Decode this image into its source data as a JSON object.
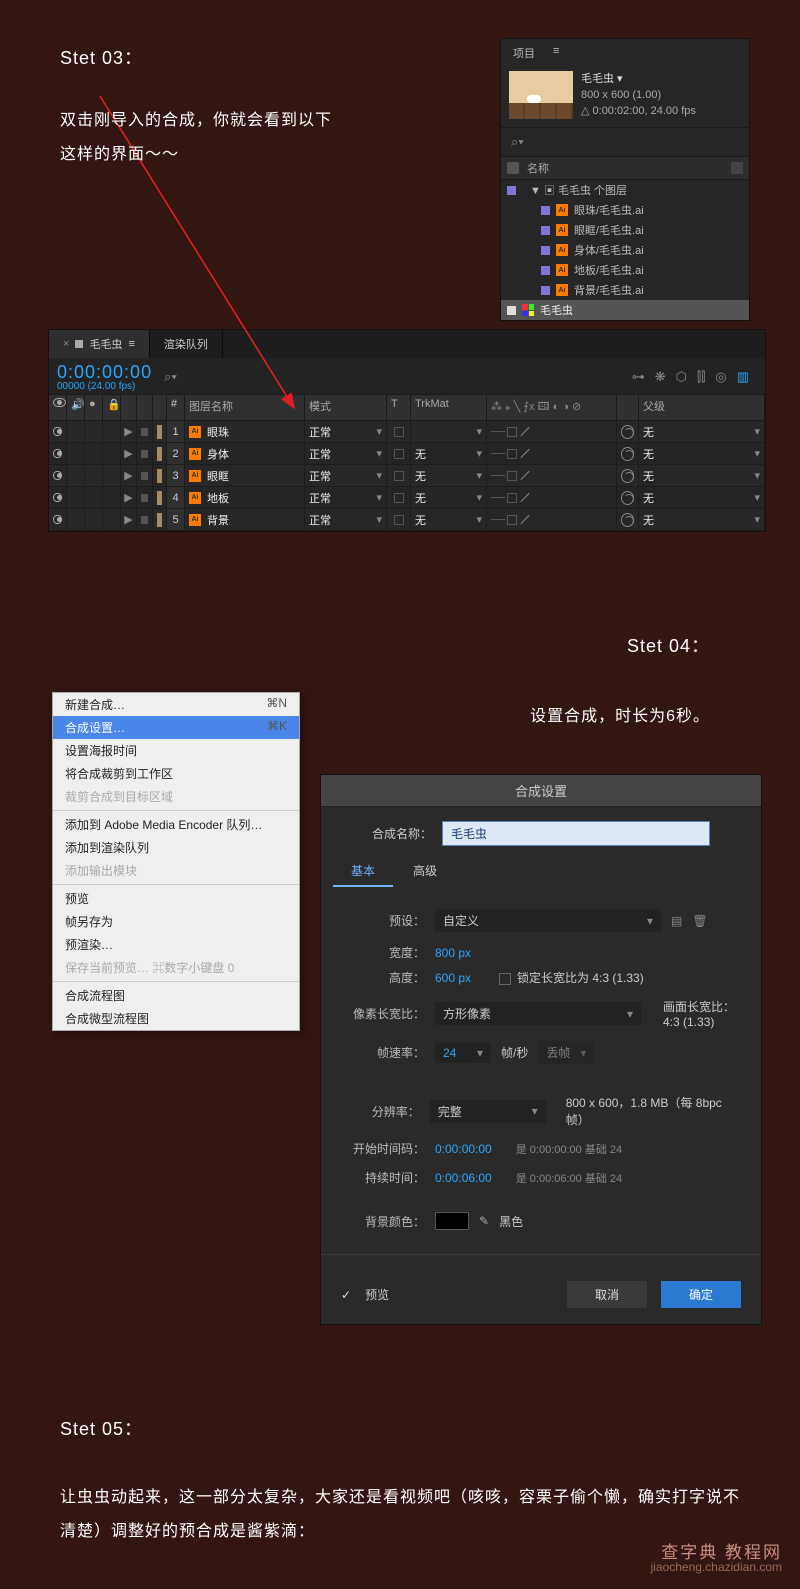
{
  "step3": {
    "title": "Stet 03：",
    "text1": "双击刚导入的合成，你就会看到以下",
    "text2": "这样的界面～～"
  },
  "step4": {
    "title": "Stet 04：",
    "text": "设置合成，时长为6秒。"
  },
  "step5": {
    "title": "Stet 05：",
    "text": "让虫虫动起来，这一部分太复杂，大家还是看视频吧（咳咳，容栗子偷个懒，确实打字说不清楚）调整好的预合成是酱紫滴："
  },
  "project": {
    "tab": "项目",
    "menu_glyph": "≡",
    "comp_name": "毛毛虫 ▾",
    "dims": "800 x 600 (1.00)",
    "duration": "△ 0:00:02:00, 24.00 fps",
    "search_glyph": "⌕▾",
    "tag_col": "",
    "name_col": "名称",
    "folder": "▼ ▣ 毛毛虫 个图层",
    "assets": [
      "眼珠/毛毛虫.ai",
      "眼眶/毛毛虫.ai",
      "身体/毛毛虫.ai",
      "地板/毛毛虫.ai",
      "背景/毛毛虫.ai"
    ],
    "bottom_comp": "毛毛虫"
  },
  "timeline": {
    "tabs": {
      "active": "毛毛虫",
      "menu_glyph": "≡",
      "render": "渲染队列"
    },
    "timecode": "0:00:00:00",
    "sub": "00000 (24.00 fps)",
    "search_glyph": "⌕▾",
    "headers": {
      "hnum": "#",
      "name": "图层名称",
      "mode": "模式",
      "t": "T",
      "trk": "TrkMat",
      "switches": "⁂ ⁎ ╲ ⨍x 🖽 ◐ ◑ ⊘",
      "parent": "父级"
    },
    "rows": [
      {
        "num": "1",
        "name": "眼珠",
        "mode": "正常",
        "trk": "",
        "parent": "无"
      },
      {
        "num": "2",
        "name": "身体",
        "mode": "正常",
        "trk": "无",
        "parent": "无"
      },
      {
        "num": "3",
        "name": "眼眶",
        "mode": "正常",
        "trk": "无",
        "parent": "无"
      },
      {
        "num": "4",
        "name": "地板",
        "mode": "正常",
        "trk": "无",
        "parent": "无"
      },
      {
        "num": "5",
        "name": "背景",
        "mode": "正常",
        "trk": "无",
        "parent": "无"
      }
    ]
  },
  "menu": {
    "new_comp": "新建合成…",
    "new_comp_sc": "⌘N",
    "comp_settings": "合成设置…",
    "comp_settings_sc": "⌘K",
    "poster": "设置海报时间",
    "crop": "将合成裁剪到工作区",
    "crop_target": "裁剪合成到目标区域",
    "ame": "添加到 Adobe Media Encoder 队列…",
    "render_q": "添加到渲染队列",
    "output_mod": "添加输出模块",
    "preview": "预览",
    "save_frame": "帧另存为",
    "prerender": "预渲染…",
    "save_preview": "保存当前预览…   ⌘数字小键盘 0",
    "flowchart": "合成流程图",
    "miniflow": "合成微型流程图"
  },
  "dialog": {
    "title": "合成设置",
    "name_label": "合成名称：",
    "name_value": "毛毛虫",
    "tab_basic": "基本",
    "tab_advanced": "高级",
    "preset_label": "预设：",
    "preset_value": "自定义",
    "width_label": "宽度：",
    "width_value": "800 px",
    "height_label": "高度：",
    "height_value": "600 px",
    "lock_aspect": "锁定长宽比为 4:3 (1.33)",
    "par_label": "像素长宽比：",
    "par_value": "方形像素",
    "frame_aspect_label": "画面长宽比：",
    "frame_aspect_value": "4:3 (1.33)",
    "fps_label": "帧速率：",
    "fps_value": "24",
    "fps_unit": "帧/秒",
    "drop": "丢帧",
    "res_label": "分辨率：",
    "res_value": "完整",
    "res_info": "800 x 600，1.8 MB（每 8bpc 帧）",
    "start_label": "开始时间码：",
    "start_value": "0:00:00:00",
    "start_note": "是 0:00:00:00 基础 24",
    "dur_label": "持续时间：",
    "dur_value": "0:00:06:00",
    "dur_note": "是 0:00:06:00 基础 24",
    "bg_label": "背景颜色：",
    "bg_name": "黑色",
    "preview_chk": "预览",
    "cancel": "取消",
    "ok": "确定"
  },
  "watermark": {
    "title": "查字典 教程网",
    "url": "jiaocheng.chazidian.com"
  }
}
